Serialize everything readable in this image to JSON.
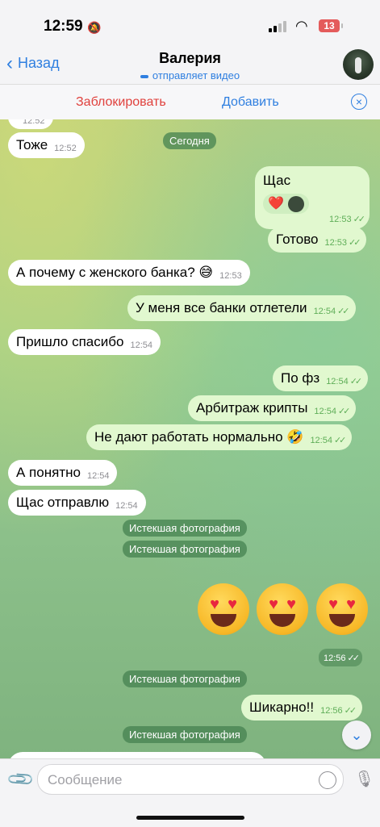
{
  "status": {
    "time": "12:59",
    "battery": "13"
  },
  "header": {
    "back_label": "Назад",
    "title": "Валерия",
    "subtitle": "отправляет видео"
  },
  "actions": {
    "block": "Заблокировать",
    "add": "Добавить"
  },
  "chat": {
    "partial_top_time": "12:52",
    "date_chip": "Сегодня",
    "messages": [
      {
        "dir": "in",
        "text": "Тоже",
        "time": "12:52"
      },
      {
        "dir": "out",
        "text": "Щас",
        "time": "12:53"
      },
      {
        "dir": "out",
        "text": "Готово",
        "time": "12:53"
      },
      {
        "dir": "in",
        "text": "А почему с женского банка? 😅",
        "time": "12:53"
      },
      {
        "dir": "out",
        "text": "У меня все банки отлетели",
        "time": "12:54"
      },
      {
        "dir": "in",
        "text": "Пришло спасибо",
        "time": "12:54"
      },
      {
        "dir": "out",
        "text": "По фз",
        "time": "12:54"
      },
      {
        "dir": "out",
        "text": "Арбитраж крипты",
        "time": "12:54"
      },
      {
        "dir": "out",
        "text": "Не дают работать нормально 🤣",
        "time": "12:54"
      },
      {
        "dir": "in",
        "text": "А понятно",
        "time": "12:54"
      },
      {
        "dir": "in",
        "text": "Щас отправлю",
        "time": "12:54"
      },
      {
        "dir": "out",
        "text": "Шикарно!!",
        "time": "12:56"
      }
    ],
    "expired_photo": "Истекшая фотография",
    "emoji_time": "12:56",
    "reaction_heart": "❤️"
  },
  "composer": {
    "placeholder": "Сообщение"
  }
}
